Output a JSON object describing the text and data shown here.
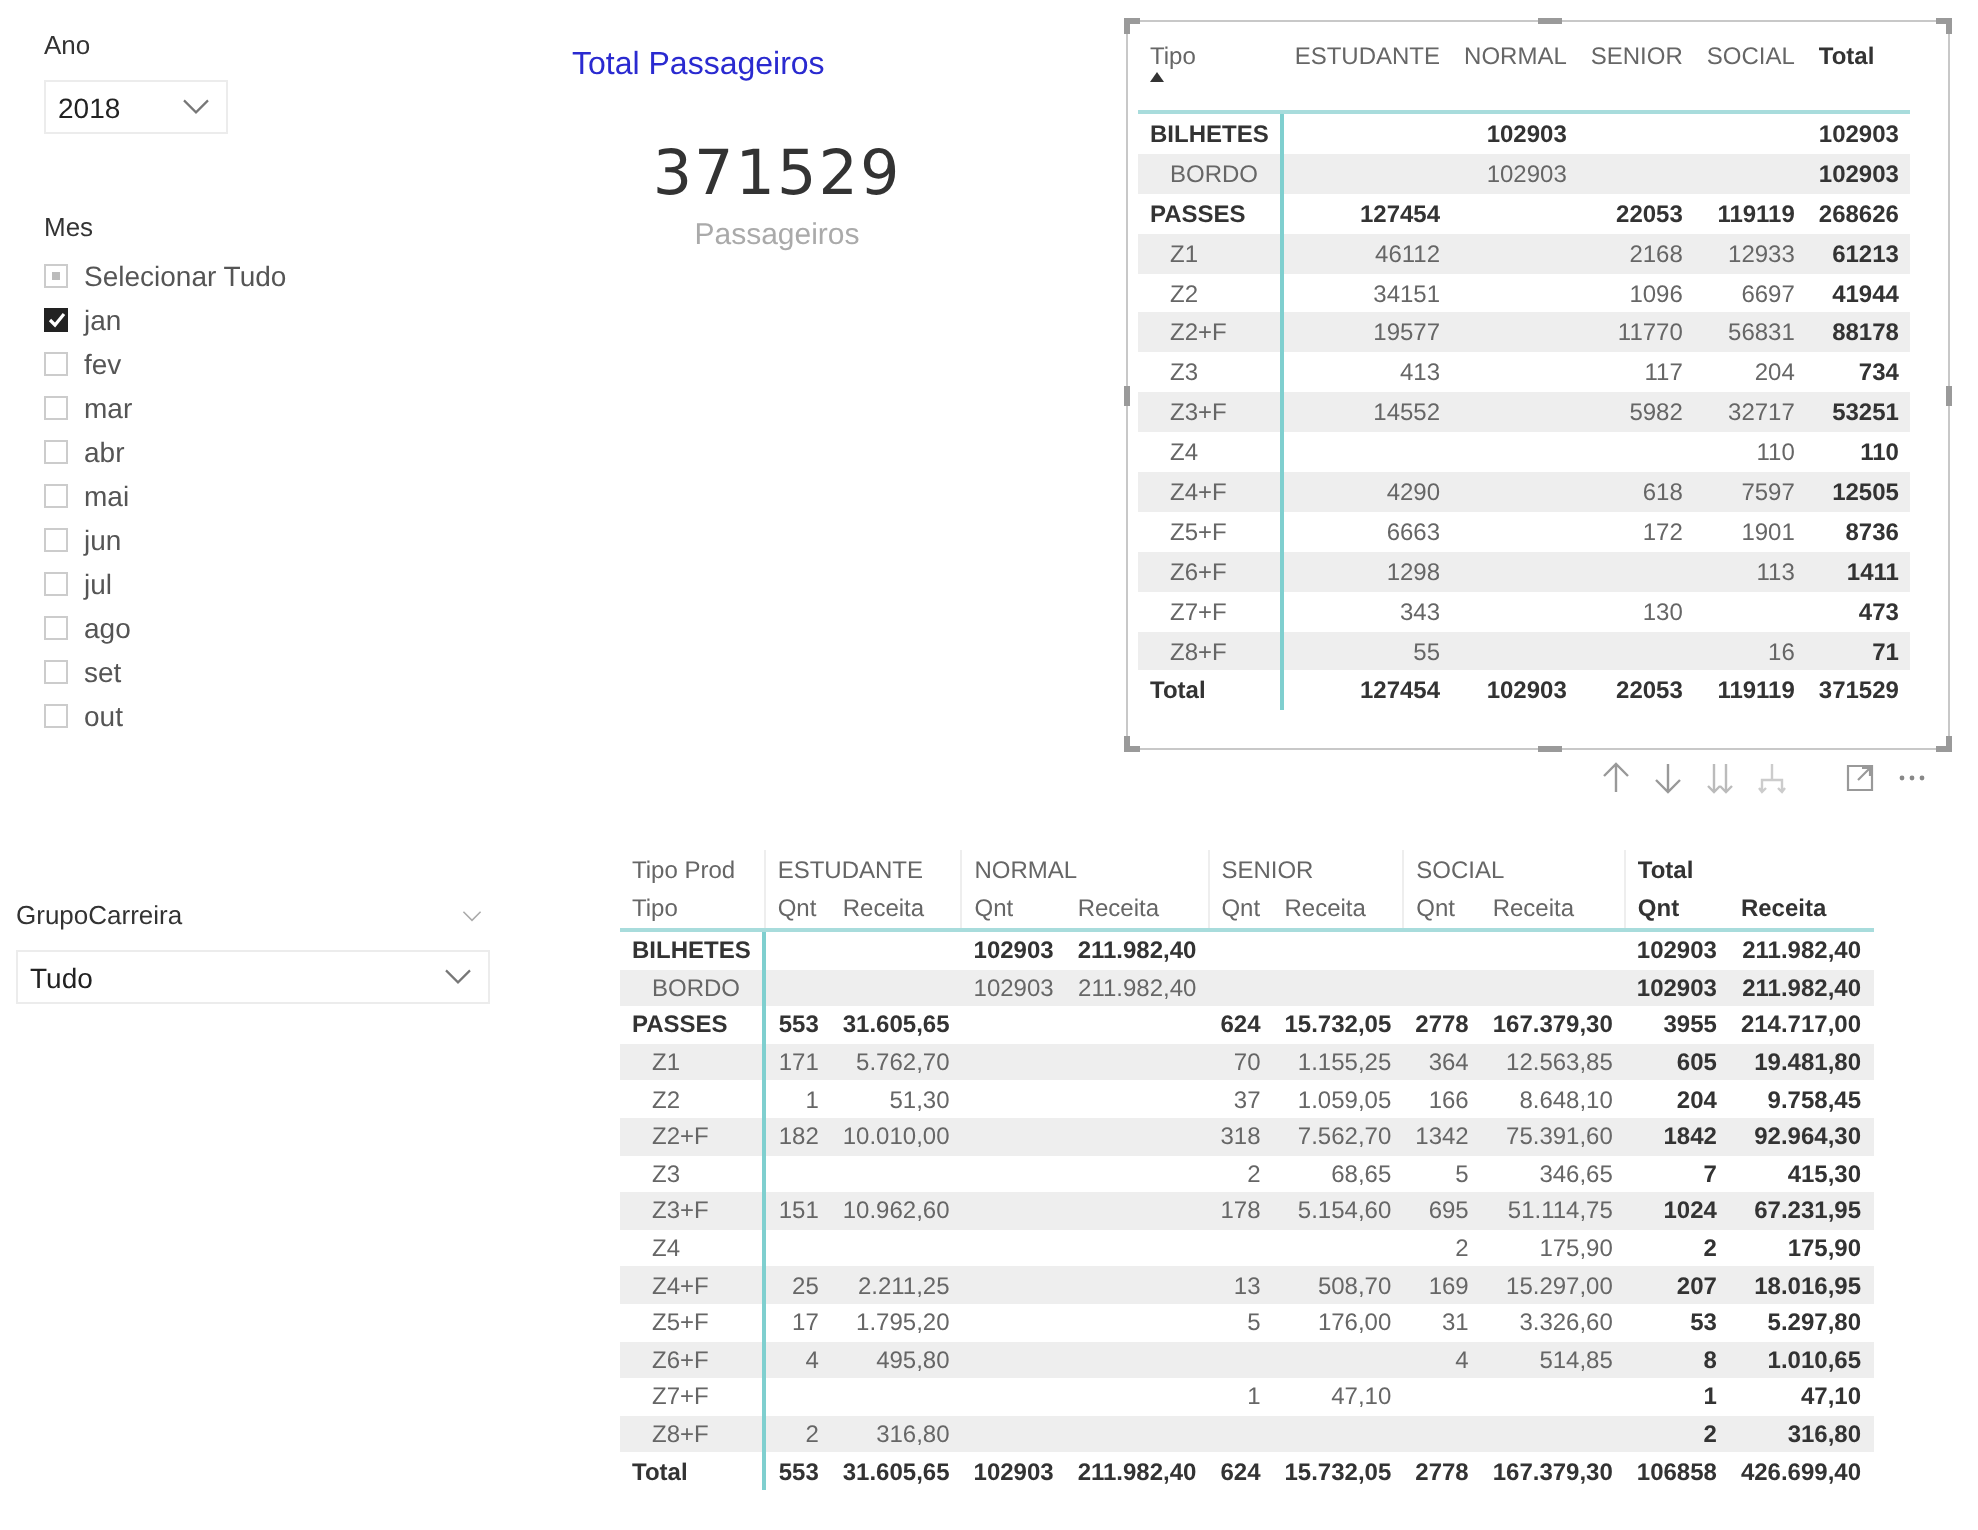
{
  "ano_slicer": {
    "title": "Ano",
    "value": "2018"
  },
  "mes_slicer": {
    "title": "Mes",
    "select_all": {
      "label": "Selecionar Tudo",
      "partial": true
    },
    "items": [
      {
        "label": "jan",
        "checked": true
      },
      {
        "label": "fev",
        "checked": false
      },
      {
        "label": "mar",
        "checked": false
      },
      {
        "label": "abr",
        "checked": false
      },
      {
        "label": "mai",
        "checked": false
      },
      {
        "label": "jun",
        "checked": false
      },
      {
        "label": "jul",
        "checked": false
      },
      {
        "label": "ago",
        "checked": false
      },
      {
        "label": "set",
        "checked": false
      },
      {
        "label": "out",
        "checked": false
      }
    ]
  },
  "card": {
    "title": "Total Passageiros",
    "value": "371529",
    "caption": "Passageiros"
  },
  "summary_table": {
    "row_header": {
      "label": "Tipo",
      "sorted": true
    },
    "columns": [
      {
        "label": "ESTUDANTE",
        "kind": "category"
      },
      {
        "label": "NORMAL",
        "kind": "category"
      },
      {
        "label": "SENIOR",
        "kind": "category"
      },
      {
        "label": "SOCIAL",
        "kind": "category"
      },
      {
        "label": "Total",
        "kind": "total"
      }
    ],
    "rows": [
      {
        "kind": "group",
        "label": "BILHETES",
        "cells": [
          null,
          "102903",
          null,
          null,
          "102903"
        ]
      },
      {
        "kind": "item",
        "label": "BORDO",
        "cells": [
          null,
          "102903",
          null,
          null,
          "102903"
        ]
      },
      {
        "kind": "group",
        "label": "PASSES",
        "cells": [
          "127454",
          null,
          "22053",
          "119119",
          "268626"
        ]
      },
      {
        "kind": "item",
        "label": "Z1",
        "cells": [
          "46112",
          null,
          "2168",
          "12933",
          "61213"
        ]
      },
      {
        "kind": "item",
        "label": "Z2",
        "cells": [
          "34151",
          null,
          "1096",
          "6697",
          "41944"
        ]
      },
      {
        "kind": "item",
        "label": "Z2+F",
        "cells": [
          "19577",
          null,
          "11770",
          "56831",
          "88178"
        ]
      },
      {
        "kind": "item",
        "label": "Z3",
        "cells": [
          "413",
          null,
          "117",
          "204",
          "734"
        ]
      },
      {
        "kind": "item",
        "label": "Z3+F",
        "cells": [
          "14552",
          null,
          "5982",
          "32717",
          "53251"
        ]
      },
      {
        "kind": "item",
        "label": "Z4",
        "cells": [
          null,
          null,
          null,
          "110",
          "110"
        ]
      },
      {
        "kind": "item",
        "label": "Z4+F",
        "cells": [
          "4290",
          null,
          "618",
          "7597",
          "12505"
        ]
      },
      {
        "kind": "item",
        "label": "Z5+F",
        "cells": [
          "6663",
          null,
          "172",
          "1901",
          "8736"
        ]
      },
      {
        "kind": "item",
        "label": "Z6+F",
        "cells": [
          "1298",
          null,
          null,
          "113",
          "1411"
        ]
      },
      {
        "kind": "item",
        "label": "Z7+F",
        "cells": [
          "343",
          null,
          "130",
          null,
          "473"
        ]
      },
      {
        "kind": "item",
        "label": "Z8+F",
        "cells": [
          "55",
          null,
          null,
          "16",
          "71"
        ]
      },
      {
        "kind": "total",
        "label": "Total",
        "cells": [
          "127454",
          "102903",
          "22053",
          "119119",
          "371529"
        ]
      }
    ]
  },
  "grupo_slicer": {
    "title": "GrupoCarreira",
    "value": "Tudo"
  },
  "detail_table": {
    "row_header": [
      "Tipo Prod",
      "Tipo"
    ],
    "groups": [
      {
        "label": "ESTUDANTE",
        "kind": "category",
        "columns": [
          "Qnt",
          "Receita"
        ]
      },
      {
        "label": "NORMAL",
        "kind": "category",
        "columns": [
          "Qnt",
          "Receita"
        ]
      },
      {
        "label": "SENIOR",
        "kind": "category",
        "columns": [
          "Qnt",
          "Receita"
        ]
      },
      {
        "label": "SOCIAL",
        "kind": "category",
        "columns": [
          "Qnt",
          "Receita"
        ]
      },
      {
        "label": "Total",
        "kind": "total",
        "columns": [
          "Qnt",
          "Receita"
        ]
      }
    ],
    "rows": [
      {
        "kind": "group",
        "label": "BILHETES",
        "cells": [
          null,
          null,
          "102903",
          "211.982,40",
          null,
          null,
          null,
          null,
          "102903",
          "211.982,40"
        ]
      },
      {
        "kind": "item",
        "label": "BORDO",
        "cells": [
          null,
          null,
          "102903",
          "211.982,40",
          null,
          null,
          null,
          null,
          "102903",
          "211.982,40"
        ]
      },
      {
        "kind": "group",
        "label": "PASSES",
        "cells": [
          "553",
          "31.605,65",
          null,
          null,
          "624",
          "15.732,05",
          "2778",
          "167.379,30",
          "3955",
          "214.717,00"
        ]
      },
      {
        "kind": "item",
        "label": "Z1",
        "cells": [
          "171",
          "5.762,70",
          null,
          null,
          "70",
          "1.155,25",
          "364",
          "12.563,85",
          "605",
          "19.481,80"
        ]
      },
      {
        "kind": "item",
        "label": "Z2",
        "cells": [
          "1",
          "51,30",
          null,
          null,
          "37",
          "1.059,05",
          "166",
          "8.648,10",
          "204",
          "9.758,45"
        ]
      },
      {
        "kind": "item",
        "label": "Z2+F",
        "cells": [
          "182",
          "10.010,00",
          null,
          null,
          "318",
          "7.562,70",
          "1342",
          "75.391,60",
          "1842",
          "92.964,30"
        ]
      },
      {
        "kind": "item",
        "label": "Z3",
        "cells": [
          null,
          null,
          null,
          null,
          "2",
          "68,65",
          "5",
          "346,65",
          "7",
          "415,30"
        ]
      },
      {
        "kind": "item",
        "label": "Z3+F",
        "cells": [
          "151",
          "10.962,60",
          null,
          null,
          "178",
          "5.154,60",
          "695",
          "51.114,75",
          "1024",
          "67.231,95"
        ]
      },
      {
        "kind": "item",
        "label": "Z4",
        "cells": [
          null,
          null,
          null,
          null,
          null,
          null,
          "2",
          "175,90",
          "2",
          "175,90"
        ]
      },
      {
        "kind": "item",
        "label": "Z4+F",
        "cells": [
          "25",
          "2.211,25",
          null,
          null,
          "13",
          "508,70",
          "169",
          "15.297,00",
          "207",
          "18.016,95"
        ]
      },
      {
        "kind": "item",
        "label": "Z5+F",
        "cells": [
          "17",
          "1.795,20",
          null,
          null,
          "5",
          "176,00",
          "31",
          "3.326,60",
          "53",
          "5.297,80"
        ]
      },
      {
        "kind": "item",
        "label": "Z6+F",
        "cells": [
          "4",
          "495,80",
          null,
          null,
          null,
          null,
          "4",
          "514,85",
          "8",
          "1.010,65"
        ]
      },
      {
        "kind": "item",
        "label": "Z7+F",
        "cells": [
          null,
          null,
          null,
          null,
          "1",
          "47,10",
          null,
          null,
          "1",
          "47,10"
        ]
      },
      {
        "kind": "item",
        "label": "Z8+F",
        "cells": [
          "2",
          "316,80",
          null,
          null,
          null,
          null,
          null,
          null,
          "2",
          "316,80"
        ]
      },
      {
        "kind": "total",
        "label": "Total",
        "cells": [
          "553",
          "31.605,65",
          "102903",
          "211.982,40",
          "624",
          "15.732,05",
          "2778",
          "167.379,30",
          "106858",
          "426.699,40"
        ]
      }
    ]
  }
}
